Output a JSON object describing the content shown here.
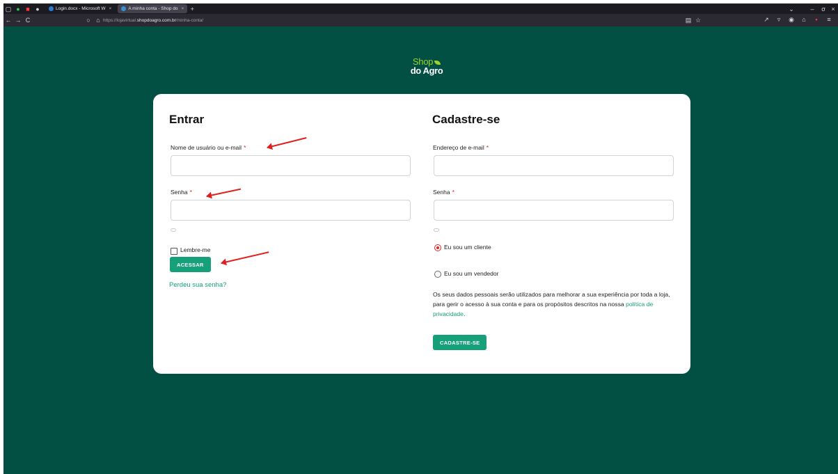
{
  "browser": {
    "tabs": [
      {
        "label": "Login.docx - Microsoft W",
        "active": false
      },
      {
        "label": "A minha conta - Shop do",
        "active": true
      }
    ],
    "url_prefix": "https://lojavirtual.",
    "url_host": "shopdoagro.com.br",
    "url_path": "/minha-conta/"
  },
  "logo": {
    "line1": "Shop",
    "line2": "do Agro"
  },
  "login": {
    "title": "Entrar",
    "username_label": "Nome de usuário ou e-mail",
    "password_label": "Senha",
    "required_mark": "*",
    "remember_label": "Lembre-me",
    "submit_label": "ACESSAR",
    "lost_password": "Perdeu sua senha?"
  },
  "register": {
    "title": "Cadastre-se",
    "email_label": "Endereço de e-mail",
    "password_label": "Senha",
    "required_mark": "*",
    "role_options": [
      {
        "label": "Eu sou um cliente",
        "selected": true
      },
      {
        "label": "Eu sou um vendedor",
        "selected": false
      }
    ],
    "policy_text": "Os seus dados pessoais serão utilizados para melhorar a sua experiência por toda a loja, para gerir o acesso à sua conta e para os propósitos descritos na nossa ",
    "policy_link": "política de privacidade",
    "policy_end": ".",
    "submit_label": "CADASTRE-SE"
  },
  "colors": {
    "page_bg": "#024f44",
    "accent": "#15a079",
    "logo_green": "#9bd32e",
    "required": "#e02424",
    "annotation_arrow": "#e02020"
  }
}
